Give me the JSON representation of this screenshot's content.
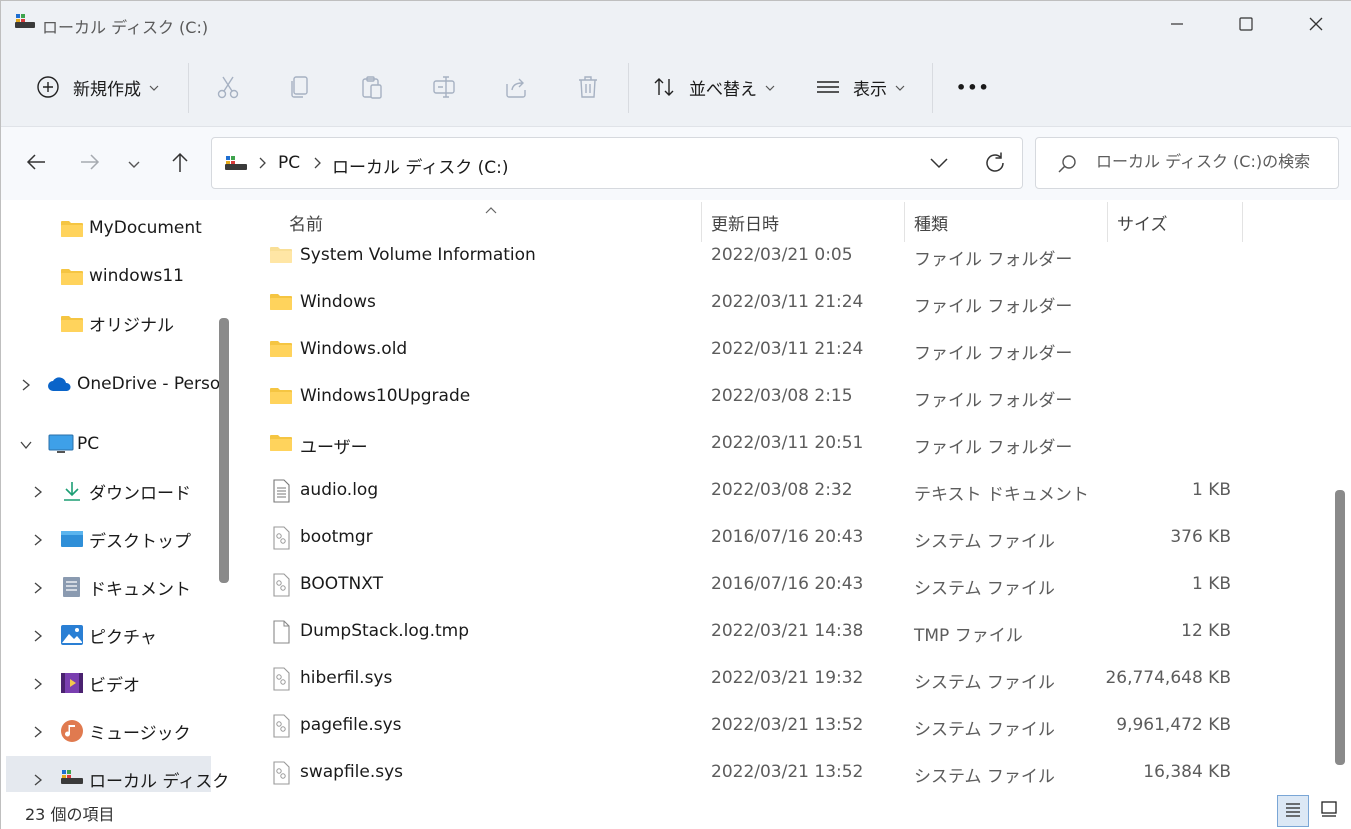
{
  "window": {
    "title": "ローカル ディスク (C:)"
  },
  "toolbar": {
    "new_label": "新規作成",
    "sort_label": "並べ替え",
    "view_label": "表示",
    "more_label": "•••"
  },
  "nav": {
    "breadcrumb": [
      "PC",
      "ローカル ディスク (C:)"
    ],
    "search_placeholder": "ローカル ディスク (C:)の検索"
  },
  "sidebar": {
    "items": [
      {
        "label": "MyDocument",
        "icon": "folder-icon"
      },
      {
        "label": "windows11",
        "icon": "folder-icon"
      },
      {
        "label": "オリジナル",
        "icon": "folder-icon"
      },
      {
        "label": "OneDrive - Perso",
        "icon": "onedrive-icon"
      },
      {
        "label": "PC",
        "icon": "pc-icon"
      },
      {
        "label": "ダウンロード",
        "icon": "download-icon"
      },
      {
        "label": "デスクトップ",
        "icon": "desktop-icon"
      },
      {
        "label": "ドキュメント",
        "icon": "documents-icon"
      },
      {
        "label": "ピクチャ",
        "icon": "pictures-icon"
      },
      {
        "label": "ビデオ",
        "icon": "videos-icon"
      },
      {
        "label": "ミュージック",
        "icon": "music-icon"
      },
      {
        "label": "ローカル ディスク (",
        "icon": "drive-icon"
      }
    ]
  },
  "columns": {
    "name": "名前",
    "modified": "更新日時",
    "type": "種類",
    "size": "サイズ"
  },
  "files": [
    {
      "name": "System Volume Information",
      "modified": "2022/03/21 0:05",
      "type": "ファイル フォルダー",
      "size": "",
      "icon": "folder-icon"
    },
    {
      "name": "Windows",
      "modified": "2022/03/11 21:24",
      "type": "ファイル フォルダー",
      "size": "",
      "icon": "folder-icon"
    },
    {
      "name": "Windows.old",
      "modified": "2022/03/11 21:24",
      "type": "ファイル フォルダー",
      "size": "",
      "icon": "folder-icon"
    },
    {
      "name": "Windows10Upgrade",
      "modified": "2022/03/08 2:15",
      "type": "ファイル フォルダー",
      "size": "",
      "icon": "folder-icon"
    },
    {
      "name": "ユーザー",
      "modified": "2022/03/11 20:51",
      "type": "ファイル フォルダー",
      "size": "",
      "icon": "folder-icon"
    },
    {
      "name": "audio.log",
      "modified": "2022/03/08 2:32",
      "type": "テキスト ドキュメント",
      "size": "1 KB",
      "icon": "text-file-icon"
    },
    {
      "name": "bootmgr",
      "modified": "2016/07/16 20:43",
      "type": "システム ファイル",
      "size": "376 KB",
      "icon": "system-file-icon"
    },
    {
      "name": "BOOTNXT",
      "modified": "2016/07/16 20:43",
      "type": "システム ファイル",
      "size": "1 KB",
      "icon": "system-file-icon"
    },
    {
      "name": "DumpStack.log.tmp",
      "modified": "2022/03/21 14:38",
      "type": "TMP ファイル",
      "size": "12 KB",
      "icon": "blank-file-icon"
    },
    {
      "name": "hiberfil.sys",
      "modified": "2022/03/21 19:32",
      "type": "システム ファイル",
      "size": "26,774,648 KB",
      "icon": "system-file-icon"
    },
    {
      "name": "pagefile.sys",
      "modified": "2022/03/21 13:52",
      "type": "システム ファイル",
      "size": "9,961,472 KB",
      "icon": "system-file-icon"
    },
    {
      "name": "swapfile.sys",
      "modified": "2022/03/21 13:52",
      "type": "システム ファイル",
      "size": "16,384 KB",
      "icon": "system-file-icon"
    }
  ],
  "status": {
    "item_count": "23 個の項目"
  },
  "colors": {
    "titlebar_bg": "#eef1f5",
    "folder_yellow": "#f5c542",
    "accent_blue": "#0078d4",
    "selected_bg": "#e5e9ef"
  }
}
